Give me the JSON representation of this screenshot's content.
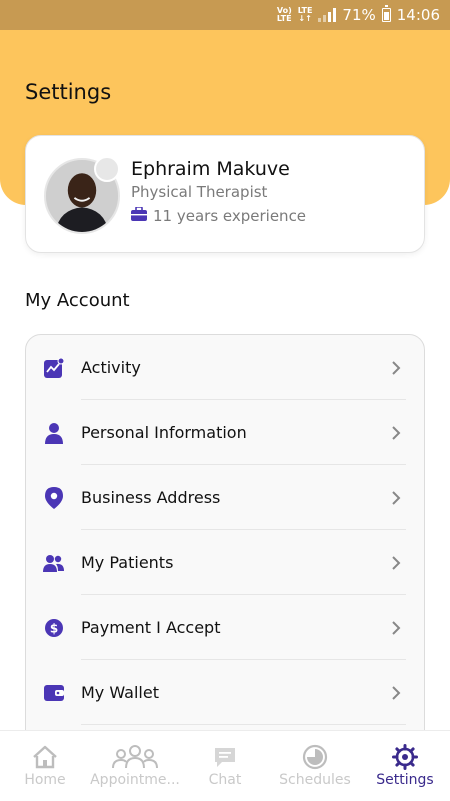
{
  "status_bar": {
    "volte_top": "Vo)",
    "volte_bottom": "LTE",
    "lte_top": "LTE",
    "lte_bottom": "↓↑",
    "battery": "71%",
    "time": "14:06"
  },
  "header": {
    "title": "Settings"
  },
  "profile": {
    "name": "Ephraim Makuve",
    "role": "Physical Therapist",
    "experience": "11 years experience"
  },
  "my_account": {
    "title": "My Account",
    "items": [
      {
        "label": "Activity",
        "icon": "activity-chart-icon"
      },
      {
        "label": "Personal Information",
        "icon": "person-icon"
      },
      {
        "label": "Business Address",
        "icon": "location-pin-icon"
      },
      {
        "label": "My Patients",
        "icon": "patients-icon"
      },
      {
        "label": "Payment I Accept",
        "icon": "dollar-coin-icon"
      },
      {
        "label": "My Wallet",
        "icon": "wallet-icon"
      }
    ]
  },
  "bottom_nav": {
    "items": [
      {
        "label": "Home",
        "icon": "home-icon",
        "active": false
      },
      {
        "label": "Appointme...",
        "icon": "people-group-icon",
        "active": false
      },
      {
        "label": "Chat",
        "icon": "chat-icon",
        "active": false
      },
      {
        "label": "Schedules",
        "icon": "schedules-icon",
        "active": false
      },
      {
        "label": "Settings",
        "icon": "gear-icon",
        "active": true
      }
    ]
  },
  "colors": {
    "accent": "#fdc55c",
    "status_bar": "#c79a52",
    "icon_purple": "#4b36b5",
    "active_nav": "#3a2a8c"
  }
}
